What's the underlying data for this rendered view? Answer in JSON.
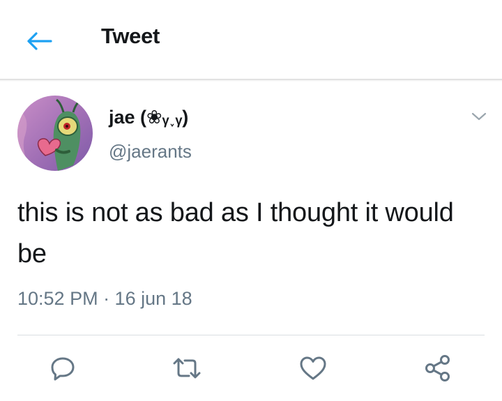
{
  "header": {
    "title": "Tweet",
    "back_icon": "arrow-left-icon",
    "accent_color": "#1da1f2"
  },
  "tweet": {
    "author_name": "jae (❀ᵧ˯ᵧ)",
    "author_handle": "@jaerants",
    "avatar": "cartoon-character-holding-heart",
    "text": "this is not as bad as I thought it would be",
    "timestamp": "10:52 PM · 16 jun 18",
    "menu_icon": "chevron-down-icon"
  },
  "actions": [
    {
      "name": "reply",
      "icon": "reply-icon"
    },
    {
      "name": "retweet",
      "icon": "retweet-icon"
    },
    {
      "name": "like",
      "icon": "heart-icon"
    },
    {
      "name": "share",
      "icon": "share-icon"
    }
  ],
  "colors": {
    "text_primary": "#14171a",
    "text_secondary": "#657786",
    "divider": "#d9dde1"
  }
}
